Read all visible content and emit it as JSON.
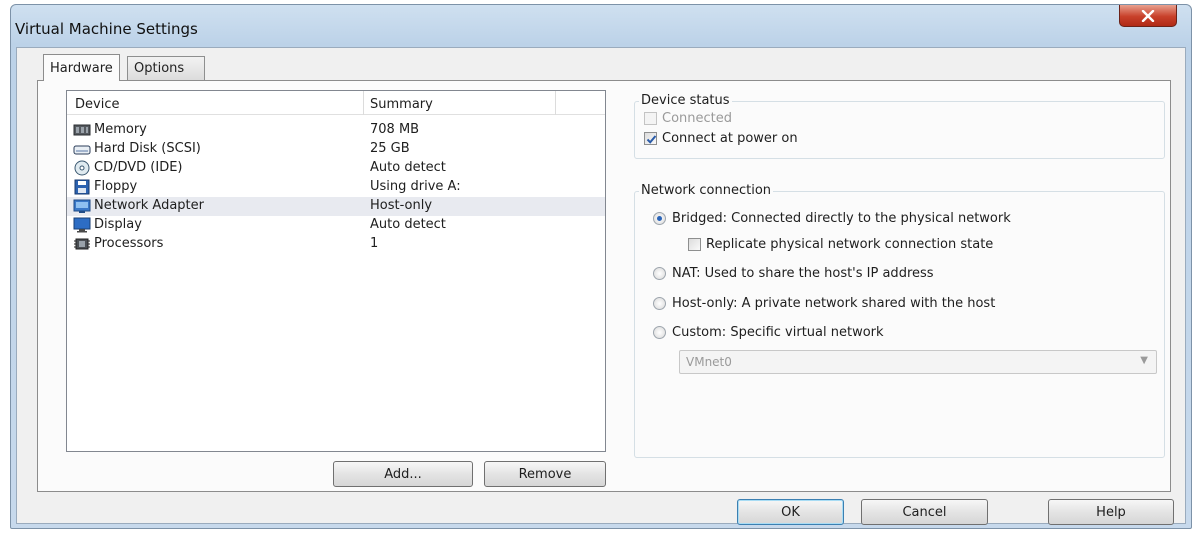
{
  "window": {
    "title": "Virtual Machine Settings"
  },
  "tabs": [
    {
      "label": "Hardware",
      "active": true
    },
    {
      "label": "Options",
      "active": false
    }
  ],
  "device_list": {
    "columns": [
      "Device",
      "Summary"
    ],
    "rows": [
      {
        "device": "Memory",
        "summary": "708 MB",
        "icon": "memory-icon"
      },
      {
        "device": "Hard Disk (SCSI)",
        "summary": "25 GB",
        "icon": "hard-disk-icon"
      },
      {
        "device": "CD/DVD (IDE)",
        "summary": "Auto detect",
        "icon": "cd-dvd-icon"
      },
      {
        "device": "Floppy",
        "summary": "Using drive A:",
        "icon": "floppy-icon"
      },
      {
        "device": "Network Adapter",
        "summary": "Host-only",
        "icon": "network-adapter-icon",
        "selected": true
      },
      {
        "device": "Display",
        "summary": "Auto detect",
        "icon": "display-icon"
      },
      {
        "device": "Processors",
        "summary": "1",
        "icon": "processor-icon"
      }
    ],
    "add_label": "Add...",
    "remove_label": "Remove"
  },
  "device_status": {
    "legend": "Device status",
    "connected_label": "Connected",
    "connected_checked": false,
    "connected_enabled": false,
    "power_on_label": "Connect at power on",
    "power_on_checked": true
  },
  "network_connection": {
    "legend": "Network connection",
    "bridged_label": "Bridged: Connected directly to the physical network",
    "replicate_label": "Replicate physical network connection state",
    "nat_label": "NAT: Used to share the host's IP address",
    "hostonly_label": "Host-only: A private network shared with the host",
    "custom_label": "Custom: Specific virtual network",
    "selected": "Bridged",
    "vmnet_value": "VMnet0"
  },
  "footer": {
    "ok_label": "OK",
    "cancel_label": "Cancel",
    "help_label": "Help"
  },
  "colors": {
    "title_bar": "#bcd2e8",
    "close_button": "#c8402a",
    "selection": "#e8eaf0",
    "radio_dot": "#2a64b8"
  }
}
